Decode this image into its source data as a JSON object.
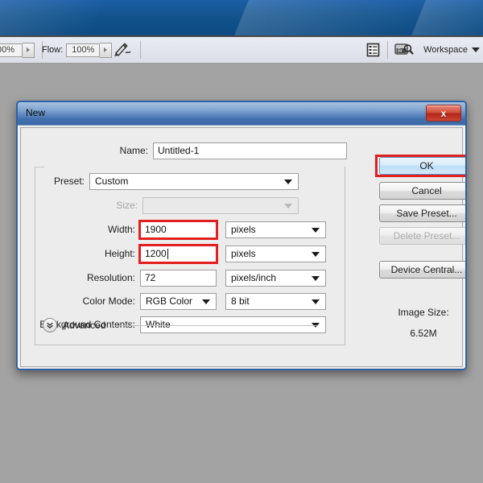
{
  "app": {
    "window_title": "",
    "background_color": "#a3a3a3",
    "titlebar_color": "#14558f"
  },
  "options_bar": {
    "opacity_value": "00%",
    "flow_label": "Flow:",
    "flow_value": "100%",
    "airbrush_icon": "airbrush-icon",
    "panels_icon": "panels-toggle-icon",
    "bridge_icon": "bridge-br-icon",
    "workspace_label": "Workspace",
    "workspace_caret": "chevron-down-icon"
  },
  "dialog": {
    "title": "New",
    "close_label": "x",
    "fields": {
      "name_label": "Name:",
      "name_value": "Untitled-1",
      "preset_label": "Preset:",
      "preset_value": "Custom",
      "size_label": "Size:",
      "size_value": "",
      "width_label": "Width:",
      "width_value": "1900",
      "width_unit": "pixels",
      "height_label": "Height:",
      "height_value": "1200",
      "height_unit": "pixels",
      "resolution_label": "Resolution:",
      "resolution_value": "72",
      "resolution_unit": "pixels/inch",
      "color_mode_label": "Color Mode:",
      "color_mode_value": "RGB Color",
      "color_depth_value": "8 bit",
      "background_label": "Background Contents:",
      "background_value": "White",
      "advanced_label": "Advanced"
    },
    "buttons": {
      "ok": "OK",
      "cancel": "Cancel",
      "save_preset": "Save Preset...",
      "delete_preset": "Delete Preset...",
      "device_central": "Device Central..."
    },
    "image_size": {
      "label": "Image Size:",
      "value": "6.52M"
    },
    "highlight_color": "#e41f1f"
  }
}
